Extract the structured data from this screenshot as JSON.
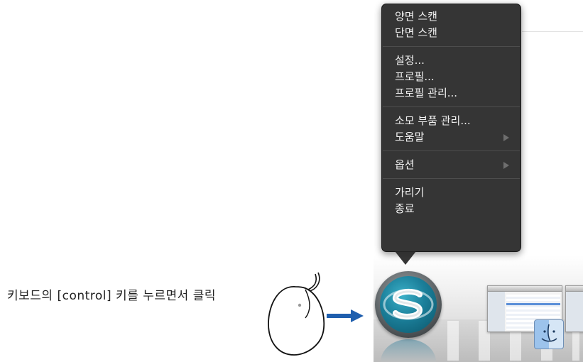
{
  "instruction": {
    "text": "키보드의 [control] 키를 누르면서 클릭"
  },
  "context_menu": {
    "groups": [
      {
        "items": [
          {
            "label": "양면 스캔",
            "submenu": false
          },
          {
            "label": "단면 스캔",
            "submenu": false
          }
        ]
      },
      {
        "items": [
          {
            "label": "설정...",
            "submenu": false
          },
          {
            "label": "프로필...",
            "submenu": false
          },
          {
            "label": "프로필 관리...",
            "submenu": false
          }
        ]
      },
      {
        "items": [
          {
            "label": "소모 부품 관리...",
            "submenu": false
          },
          {
            "label": "도움말",
            "submenu": true
          }
        ]
      },
      {
        "items": [
          {
            "label": "옵션",
            "submenu": true
          }
        ]
      },
      {
        "items": [
          {
            "label": "가리기",
            "submenu": false
          },
          {
            "label": "종료",
            "submenu": false
          }
        ]
      }
    ]
  },
  "dock": {
    "app_icon": "scansnap-manager-icon",
    "other_icons": [
      "window-thumbnail",
      "window-thumbnail",
      "finder-icon"
    ]
  },
  "colors": {
    "menu_bg": "#262626",
    "menu_text": "#f2f2f2",
    "arrow": "#1f5fae",
    "scansnap_teal": "#1b7f9a"
  }
}
